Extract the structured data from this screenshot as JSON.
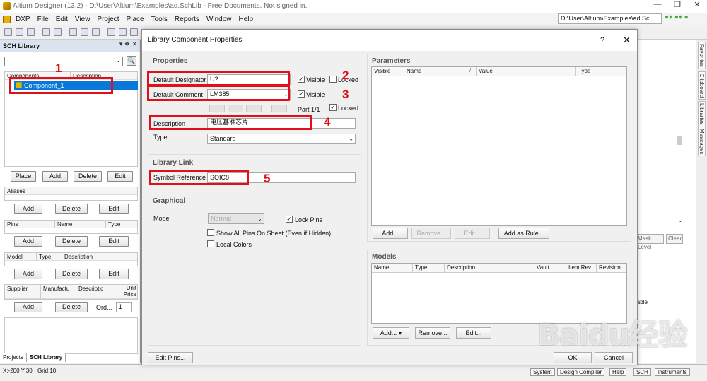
{
  "app": {
    "title": "Altium Designer (13.2) - D:\\User\\Altium\\Examples\\ad.SchLib - Free Documents. Not signed in.",
    "path": "D:\\User\\Altium\\Examples\\ad.Sc"
  },
  "menu": [
    "DXP",
    "File",
    "Edit",
    "View",
    "Project",
    "Place",
    "Tools",
    "Reports",
    "Window",
    "Help"
  ],
  "left_panel": {
    "title": "SCH Library",
    "components_headers": [
      "Components",
      "Description"
    ],
    "component_selected": "Component_1",
    "buttons": {
      "place": "Place",
      "add": "Add",
      "delete": "Delete",
      "edit": "Edit"
    },
    "aliases_header": "Aliases",
    "pins_headers": [
      "Pins",
      "Name",
      "Type"
    ],
    "model_headers": [
      "Model",
      "Type",
      "Description"
    ],
    "supplier_headers": [
      "Supplier",
      "Manufactu",
      "Descriptic",
      "Unit Price"
    ],
    "order_label": "Ord...",
    "order_value": "1",
    "tabs": [
      "Projects",
      "SCH Library"
    ]
  },
  "status": {
    "coords": "X:-200 Y:30",
    "grid": "Grid:10",
    "tabs": [
      "System",
      "Design Compiler",
      "Help",
      "SCH",
      "Instruments"
    ]
  },
  "right_strip": {
    "tabs": [
      "Favorites",
      "Clipboard",
      "Libraries",
      "Messages"
    ]
  },
  "background": {
    "mask_level": "Mask Level",
    "clear": "Clear",
    "partial_text": "lable"
  },
  "dialog": {
    "title": "Library Component Properties",
    "help": "?",
    "close": "✕",
    "properties": {
      "title": "Properties",
      "default_designator_label": "Default Designator",
      "default_designator_value": "U?",
      "visible_label": "Visible",
      "locked_label": "Locked",
      "default_comment_label": "Default Comment",
      "default_comment_value": "LM385",
      "part_label": "Part 1/1",
      "description_label": "Description",
      "description_value": "电压基准芯片",
      "type_label": "Type",
      "type_value": "Standard"
    },
    "library_link": {
      "title": "Library Link",
      "symbol_reference_label": "Symbol Reference",
      "symbol_reference_value": "SOIC8"
    },
    "graphical": {
      "title": "Graphical",
      "mode_label": "Mode",
      "mode_value": "Normal",
      "lock_pins": "Lock Pins",
      "show_all_pins": "Show All Pins On Sheet (Even if Hidden)",
      "local_colors": "Local Colors"
    },
    "parameters": {
      "title": "Parameters",
      "headers": [
        "Visible",
        "Name",
        "Value",
        "Type"
      ],
      "buttons": {
        "add": "Add...",
        "remove": "Remove...",
        "edit": "Edit...",
        "add_as_rule": "Add as Rule..."
      }
    },
    "models": {
      "title": "Models",
      "headers": [
        "Name",
        "Type",
        "Description",
        "Vault",
        "Item Rev...",
        "Revision..."
      ],
      "buttons": {
        "add": "Add...",
        "remove": "Remove...",
        "edit": "Edit..."
      }
    },
    "edit_pins": "Edit Pins...",
    "ok": "OK",
    "cancel": "Cancel"
  },
  "annotations": [
    "1",
    "2",
    "3",
    "4",
    "5"
  ],
  "watermark": "Baidu经验",
  "colors": {
    "annotation": "#e0101a",
    "selection": "#0a78d8",
    "brand": "#e8b100"
  }
}
